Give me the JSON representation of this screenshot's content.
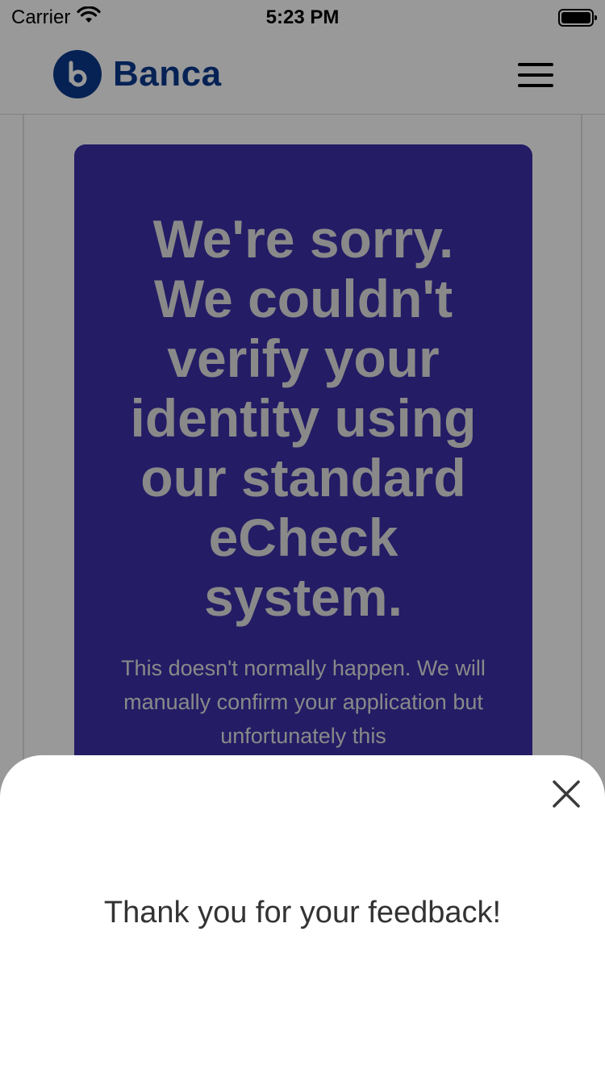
{
  "status_bar": {
    "carrier": "Carrier",
    "time": "5:23 PM",
    "icons": [
      "wifi-icon",
      "battery-icon"
    ]
  },
  "header": {
    "logo_letter": "b",
    "brand": "Banca",
    "brand_color": "#0b3a8e",
    "menu_icon": "hamburger-menu-icon"
  },
  "card": {
    "background": "#3c2fa8",
    "title": "We're sorry. We couldn't verify your identity using our standard eCheck system.",
    "body": "This doesn't normally happen. We will manually confirm your application but unfortunately this"
  },
  "sheet": {
    "close_icon": "close-icon",
    "message": "Thank you for your feedback!"
  }
}
